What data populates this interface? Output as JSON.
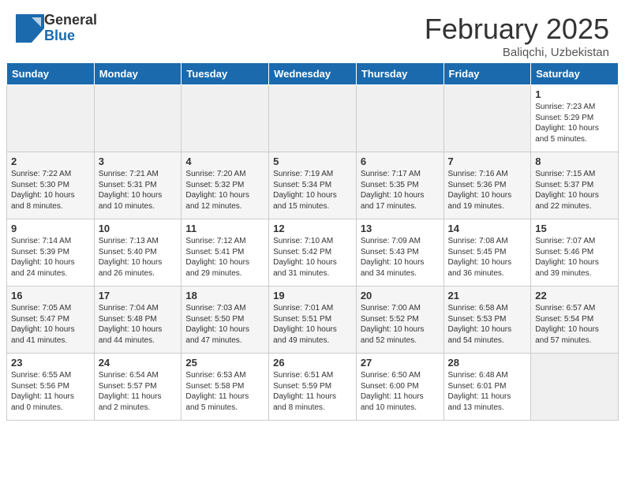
{
  "header": {
    "logo_general": "General",
    "logo_blue": "Blue",
    "month": "February 2025",
    "location": "Baliqchi, Uzbekistan"
  },
  "days_of_week": [
    "Sunday",
    "Monday",
    "Tuesday",
    "Wednesday",
    "Thursday",
    "Friday",
    "Saturday"
  ],
  "weeks": [
    [
      {
        "day": "",
        "info": ""
      },
      {
        "day": "",
        "info": ""
      },
      {
        "day": "",
        "info": ""
      },
      {
        "day": "",
        "info": ""
      },
      {
        "day": "",
        "info": ""
      },
      {
        "day": "",
        "info": ""
      },
      {
        "day": "1",
        "info": "Sunrise: 7:23 AM\nSunset: 5:29 PM\nDaylight: 10 hours\nand 5 minutes."
      }
    ],
    [
      {
        "day": "2",
        "info": "Sunrise: 7:22 AM\nSunset: 5:30 PM\nDaylight: 10 hours\nand 8 minutes."
      },
      {
        "day": "3",
        "info": "Sunrise: 7:21 AM\nSunset: 5:31 PM\nDaylight: 10 hours\nand 10 minutes."
      },
      {
        "day": "4",
        "info": "Sunrise: 7:20 AM\nSunset: 5:32 PM\nDaylight: 10 hours\nand 12 minutes."
      },
      {
        "day": "5",
        "info": "Sunrise: 7:19 AM\nSunset: 5:34 PM\nDaylight: 10 hours\nand 15 minutes."
      },
      {
        "day": "6",
        "info": "Sunrise: 7:17 AM\nSunset: 5:35 PM\nDaylight: 10 hours\nand 17 minutes."
      },
      {
        "day": "7",
        "info": "Sunrise: 7:16 AM\nSunset: 5:36 PM\nDaylight: 10 hours\nand 19 minutes."
      },
      {
        "day": "8",
        "info": "Sunrise: 7:15 AM\nSunset: 5:37 PM\nDaylight: 10 hours\nand 22 minutes."
      }
    ],
    [
      {
        "day": "9",
        "info": "Sunrise: 7:14 AM\nSunset: 5:39 PM\nDaylight: 10 hours\nand 24 minutes."
      },
      {
        "day": "10",
        "info": "Sunrise: 7:13 AM\nSunset: 5:40 PM\nDaylight: 10 hours\nand 26 minutes."
      },
      {
        "day": "11",
        "info": "Sunrise: 7:12 AM\nSunset: 5:41 PM\nDaylight: 10 hours\nand 29 minutes."
      },
      {
        "day": "12",
        "info": "Sunrise: 7:10 AM\nSunset: 5:42 PM\nDaylight: 10 hours\nand 31 minutes."
      },
      {
        "day": "13",
        "info": "Sunrise: 7:09 AM\nSunset: 5:43 PM\nDaylight: 10 hours\nand 34 minutes."
      },
      {
        "day": "14",
        "info": "Sunrise: 7:08 AM\nSunset: 5:45 PM\nDaylight: 10 hours\nand 36 minutes."
      },
      {
        "day": "15",
        "info": "Sunrise: 7:07 AM\nSunset: 5:46 PM\nDaylight: 10 hours\nand 39 minutes."
      }
    ],
    [
      {
        "day": "16",
        "info": "Sunrise: 7:05 AM\nSunset: 5:47 PM\nDaylight: 10 hours\nand 41 minutes."
      },
      {
        "day": "17",
        "info": "Sunrise: 7:04 AM\nSunset: 5:48 PM\nDaylight: 10 hours\nand 44 minutes."
      },
      {
        "day": "18",
        "info": "Sunrise: 7:03 AM\nSunset: 5:50 PM\nDaylight: 10 hours\nand 47 minutes."
      },
      {
        "day": "19",
        "info": "Sunrise: 7:01 AM\nSunset: 5:51 PM\nDaylight: 10 hours\nand 49 minutes."
      },
      {
        "day": "20",
        "info": "Sunrise: 7:00 AM\nSunset: 5:52 PM\nDaylight: 10 hours\nand 52 minutes."
      },
      {
        "day": "21",
        "info": "Sunrise: 6:58 AM\nSunset: 5:53 PM\nDaylight: 10 hours\nand 54 minutes."
      },
      {
        "day": "22",
        "info": "Sunrise: 6:57 AM\nSunset: 5:54 PM\nDaylight: 10 hours\nand 57 minutes."
      }
    ],
    [
      {
        "day": "23",
        "info": "Sunrise: 6:55 AM\nSunset: 5:56 PM\nDaylight: 11 hours\nand 0 minutes."
      },
      {
        "day": "24",
        "info": "Sunrise: 6:54 AM\nSunset: 5:57 PM\nDaylight: 11 hours\nand 2 minutes."
      },
      {
        "day": "25",
        "info": "Sunrise: 6:53 AM\nSunset: 5:58 PM\nDaylight: 11 hours\nand 5 minutes."
      },
      {
        "day": "26",
        "info": "Sunrise: 6:51 AM\nSunset: 5:59 PM\nDaylight: 11 hours\nand 8 minutes."
      },
      {
        "day": "27",
        "info": "Sunrise: 6:50 AM\nSunset: 6:00 PM\nDaylight: 11 hours\nand 10 minutes."
      },
      {
        "day": "28",
        "info": "Sunrise: 6:48 AM\nSunset: 6:01 PM\nDaylight: 11 hours\nand 13 minutes."
      },
      {
        "day": "",
        "info": ""
      }
    ]
  ]
}
